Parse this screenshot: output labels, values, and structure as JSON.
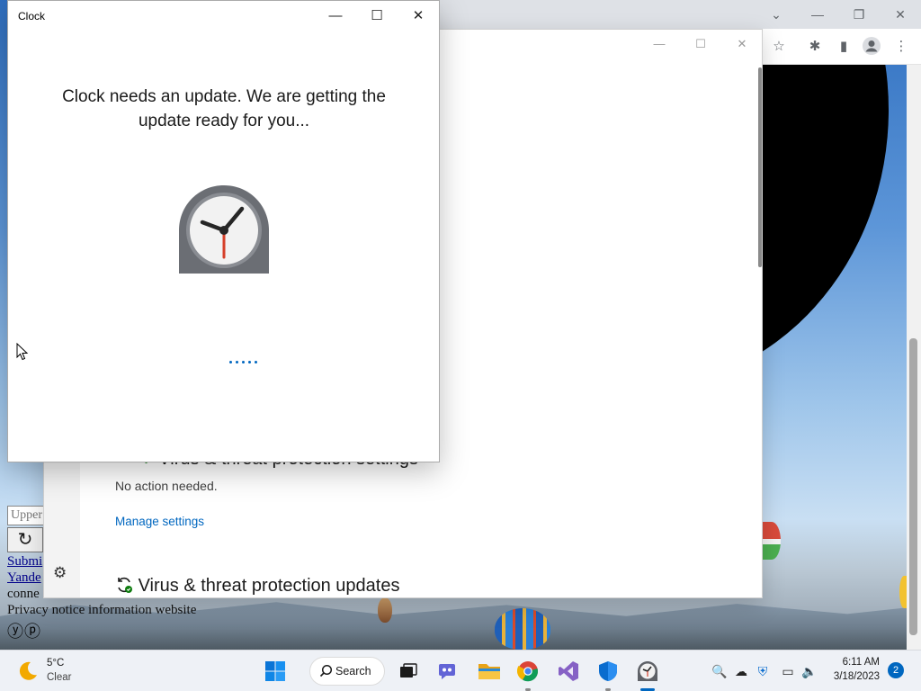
{
  "clock_window": {
    "title": "Clock",
    "message": "Clock needs an update. We are getting the update ready for you..."
  },
  "security_window": {
    "section1_title": "Virus & threat protection settings",
    "section1_status": "No action needed.",
    "section1_link": "Manage settings",
    "section2_title": "Virus & threat protection updates"
  },
  "background_page": {
    "input_value": "Upper",
    "link_submit": "Submi",
    "link_yandex": "Yande",
    "text_connect": "conne",
    "text_privacy": "Privacy notice information website",
    "logos": "ⓨⓟ"
  },
  "taskbar": {
    "weather_temp": "5°C",
    "weather_cond": "Clear",
    "search_label": "Search",
    "time": "6:11 AM",
    "date": "3/18/2023",
    "notification_count": "2"
  },
  "colors": {
    "accent": "#0067c0",
    "link": "#0067c0"
  }
}
